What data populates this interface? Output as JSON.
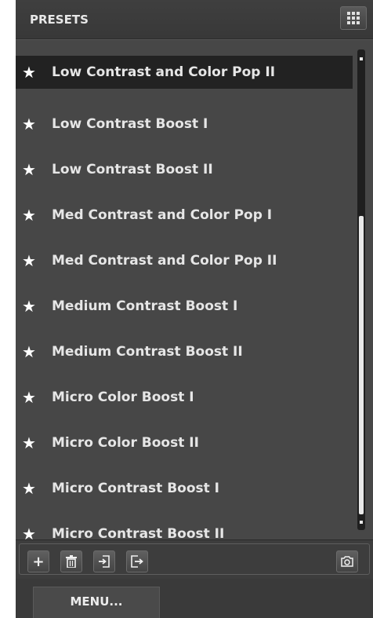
{
  "panel": {
    "title": "PRESETS"
  },
  "presets": [
    {
      "label": "Low Contrast and Color Pop II",
      "selected": true
    },
    {
      "label": "Low Contrast Boost I"
    },
    {
      "label": "Low Contrast Boost II"
    },
    {
      "label": "Med Contrast and Color Pop I"
    },
    {
      "label": "Med Contrast and Color Pop II"
    },
    {
      "label": "Medium Contrast Boost I"
    },
    {
      "label": "Medium Contrast Boost II"
    },
    {
      "label": "Micro Color Boost I"
    },
    {
      "label": "Micro Color Boost II"
    },
    {
      "label": "Micro Contrast Boost I"
    },
    {
      "label": "Micro Contrast Boost II"
    }
  ],
  "star_glyph": "★",
  "toolbar": {
    "icons": [
      "add-icon",
      "trash-icon",
      "import-icon",
      "export-icon",
      "camera-icon"
    ],
    "add_glyph": "+"
  },
  "menu": {
    "label": "MENU..."
  },
  "colors": {
    "panel_bg": "#484848",
    "selected_bg": "#222222",
    "text": "#e6e6e6"
  }
}
